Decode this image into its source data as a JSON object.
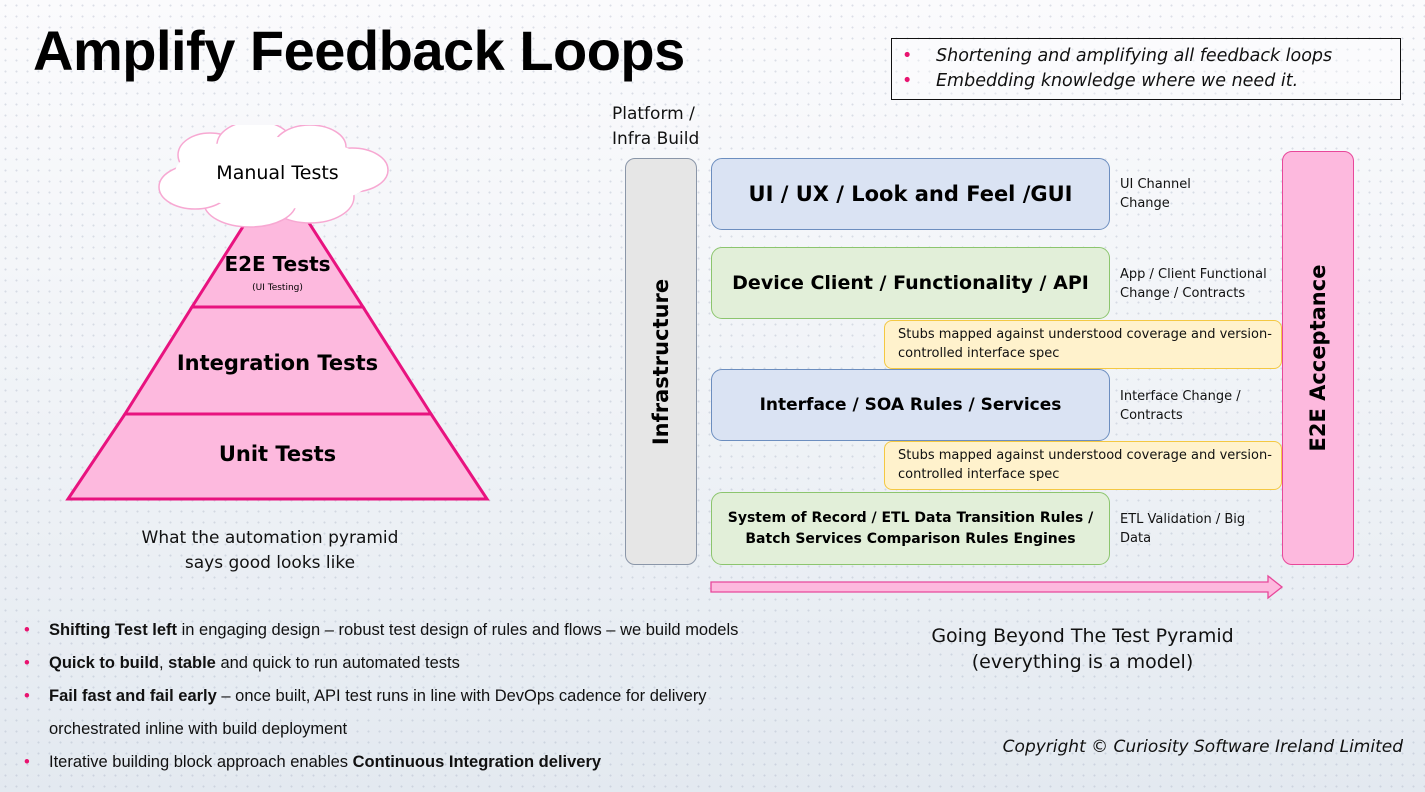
{
  "title": "Amplify Feedback Loops",
  "callout": {
    "items": [
      "Shortening and amplifying all feedback loops",
      "Embedding knowledge where we need it."
    ]
  },
  "pyramid": {
    "cloud_label": "Manual Tests",
    "levels": [
      {
        "label": "E2E Tests",
        "sublabel": "(UI Testing)"
      },
      {
        "label": "Integration Tests"
      },
      {
        "label": "Unit Tests"
      }
    ],
    "caption_line1": "What the automation pyramid",
    "caption_line2": "says good looks like"
  },
  "beyond": {
    "platform_label_line1": "Platform /",
    "platform_label_line2": "Infra Build",
    "infrastructure_label": "Infrastructure",
    "e2e_acceptance_label": "E2E Acceptance",
    "layers": [
      {
        "label": "UI / UX / Look and Feel /GUI",
        "note_line1": "UI Channel",
        "note_line2": "Change"
      },
      {
        "label": "Device Client / Functionality / API",
        "note_line1": "App / Client Functional",
        "note_line2": "Change / Contracts"
      },
      {
        "label": "Interface / SOA Rules / Services",
        "note_line1": "Interface Change /",
        "note_line2": "Contracts"
      },
      {
        "label_line1": "System of Record / ETL Data Transition Rules /",
        "label_line2": "Batch Services Comparison Rules Engines",
        "note_line1": "ETL Validation / Big",
        "note_line2": "Data"
      }
    ],
    "stubs": [
      {
        "line1": "Stubs mapped against understood coverage and version-",
        "line2": "controlled interface spec"
      },
      {
        "line1": "Stubs mapped against understood coverage and version-",
        "line2": "controlled interface spec"
      }
    ],
    "caption_line1": "Going Beyond The Test Pyramid",
    "caption_line2": "(everything is a model)"
  },
  "bullets": [
    {
      "bold": "Shifting Test left",
      "text": " in engaging design – robust test design of rules and flows – we build models"
    },
    {
      "bold": "Quick to build",
      "text_mid": ", ",
      "bold2": "stable",
      "text": " and quick to run automated tests"
    },
    {
      "bold": "Fail fast and fail early",
      "text": " – once built, API test runs in line with DevOps cadence for delivery",
      "continuation": "orchestrated inline with build deployment"
    },
    {
      "text_pre": "Iterative building block approach enables ",
      "bold": "Continuous Integration delivery"
    }
  ],
  "copyright": "Copyright © Curiosity Software Ireland Limited",
  "colors": {
    "accent_pink": "#e8136f",
    "pyramid_fill": "#fdb9de",
    "blue_layer": "#dae3f3",
    "green_layer": "#e2efd9",
    "stub_fill": "#fff2cc",
    "infra_fill": "#e6e6e6"
  }
}
